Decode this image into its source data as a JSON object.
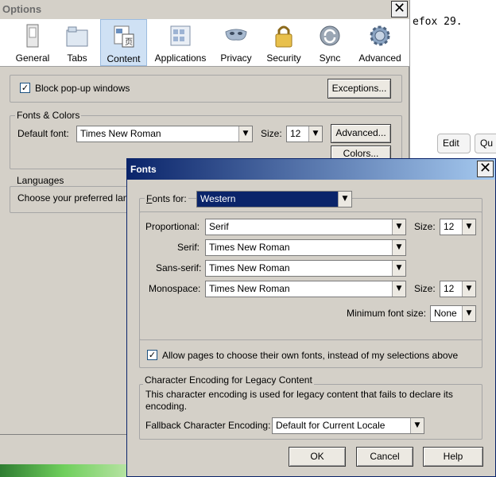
{
  "background_page": {
    "text": "efox 29.",
    "buttons": [
      "Edit",
      "Qu"
    ]
  },
  "options_window": {
    "title": "Options",
    "close_glyph": "✕",
    "tabs": [
      {
        "label": "General",
        "icon": "general-icon"
      },
      {
        "label": "Tabs",
        "icon": "tabs-icon"
      },
      {
        "label": "Content",
        "icon": "content-icon",
        "selected": true
      },
      {
        "label": "Applications",
        "icon": "applications-icon"
      },
      {
        "label": "Privacy",
        "icon": "privacy-mask-icon"
      },
      {
        "label": "Security",
        "icon": "padlock-icon"
      },
      {
        "label": "Sync",
        "icon": "sync-icon"
      },
      {
        "label": "Advanced",
        "icon": "gear-icon"
      }
    ],
    "block_popups_label": "Block pop-up windows",
    "block_popups_checked": true,
    "exceptions_button": "Exceptions...",
    "fonts_colors_legend": "Fonts & Colors",
    "default_font_label": "Default font:",
    "default_font_value": "Times New Roman",
    "size_label": "Size:",
    "size_value": "12",
    "advanced_button": "Advanced...",
    "colors_button": "Colors...",
    "languages_legend": "Languages",
    "languages_text": "Choose your preferred lang"
  },
  "fonts_dialog": {
    "title": "Fonts",
    "close_glyph": "✕",
    "fonts_for_label": "Fonts for:",
    "fonts_for_value": "Western",
    "proportional_label": "Proportional:",
    "proportional_value": "Serif",
    "serif_label": "Serif:",
    "serif_value": "Times New Roman",
    "sans_serif_label": "Sans-serif:",
    "sans_serif_value": "Times New Roman",
    "monospace_label": "Monospace:",
    "monospace_value": "Times New Roman",
    "size_label": "Size:",
    "proportional_size": "12",
    "monospace_size": "12",
    "min_font_size_label": "Minimum font size:",
    "min_font_size_value": "None",
    "allow_pages_label": "Allow pages to choose their own fonts, instead of my selections above",
    "allow_pages_checked": true,
    "encoding_legend": "Character Encoding for Legacy Content",
    "encoding_description": "This character encoding is used for legacy content that fails to declare its encoding.",
    "fallback_label": "Fallback Character Encoding:",
    "fallback_value": "Default for Current Locale",
    "ok_button": "OK",
    "cancel_button": "Cancel",
    "help_button": "Help"
  },
  "colors": {
    "selected_tab_bg": "#cfe1f4",
    "dialog_title_start": "#0a246a",
    "dialog_title_end": "#a6caf0",
    "selection_highlight": "#0a246a"
  }
}
